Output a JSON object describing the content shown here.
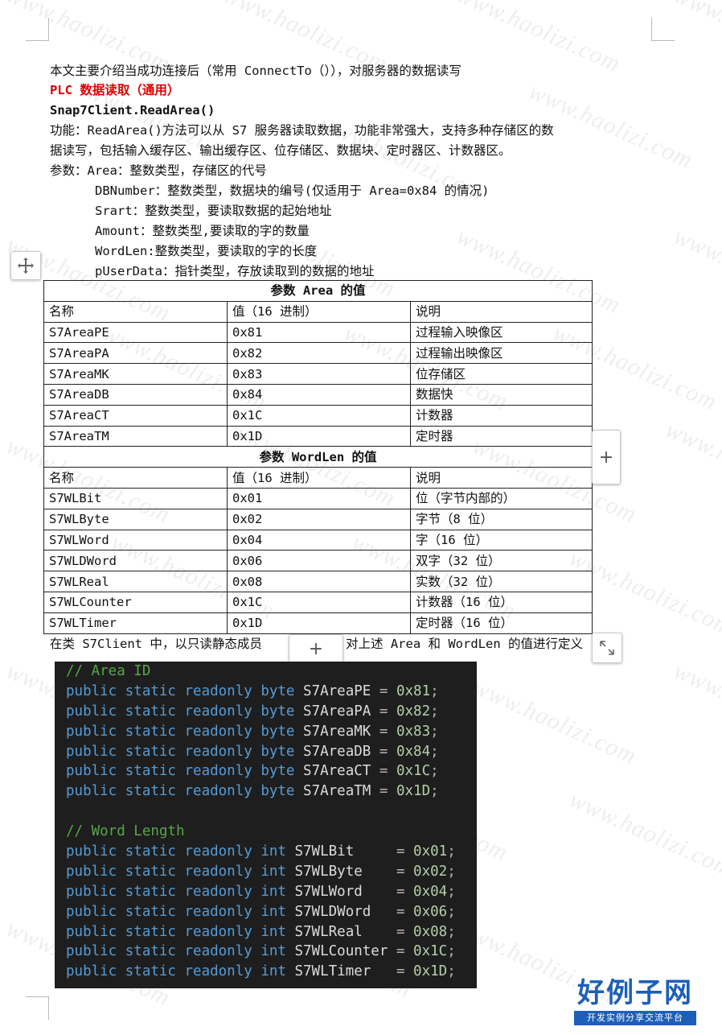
{
  "intro": {
    "line1": "本文主要介绍当成功连接后（常用 ConnectTo（）），对服务器的数据读写",
    "heading": "PLC 数据读取（通用）",
    "method": "Snap7Client.ReadArea()",
    "desc1": "功能：ReadArea()方法可以从 S7 服务器读取数据，功能非常强大，支持多种存储区的数",
    "desc2": "据读写，包括输入缓存区、输出缓存区、位存储区、数据块、定时器区、计数器区。",
    "p_area": "参数：Area：整数类型，存储区的代号",
    "p_db": "DBNumber：整数类型，数据块的编号(仅适用于 Area=0x84 的情况)",
    "p_start": "Srart：整数类型，要读取数据的起始地址",
    "p_amount": "Amount：整数类型,要读取的字的数量",
    "p_wordlen": "WordLen:整数类型，要读取的字的长度",
    "p_user": "pUserData：指针类型，存放读取到的数据的地址"
  },
  "table": {
    "area_header": "参数 Area 的值",
    "wordlen_header": "参数 WordLen 的值",
    "cols": [
      "名称",
      "值（16 进制）",
      "说明"
    ],
    "area_rows": [
      [
        "S7AreaPE",
        "0x81",
        "过程输入映像区"
      ],
      [
        "S7AreaPA",
        "0x82",
        "过程输出映像区"
      ],
      [
        "S7AreaMK",
        "0x83",
        "位存储区"
      ],
      [
        "S7AreaDB",
        "0x84",
        "数据快"
      ],
      [
        "S7AreaCT",
        "0x1C",
        "计数器"
      ],
      [
        "S7AreaTM",
        "0x1D",
        "定时器"
      ]
    ],
    "wordlen_rows": [
      [
        "S7WLBit",
        "0x01",
        "位（字节内部的）"
      ],
      [
        "S7WLByte",
        "0x02",
        "字节（8 位）"
      ],
      [
        "S7WLWord",
        "0x04",
        "字（16 位）"
      ],
      [
        "S7WLDWord",
        "0x06",
        "双字（32 位）"
      ],
      [
        "S7WLReal",
        "0x08",
        "实数（32 位）"
      ],
      [
        "S7WLCounter",
        "0x1C",
        "计数器（16 位）"
      ],
      [
        "S7WLTimer",
        "0x1D",
        "定时器（16 位）"
      ]
    ]
  },
  "after_table": {
    "left": "在类 S7Client 中，以只读静态成员",
    "right": "对上述 Area 和 WordLen 的值进行定义"
  },
  "code": {
    "comment1": "// Area ID",
    "area_lines": [
      {
        "type": "byte",
        "name": "S7AreaPE",
        "value": "0x81"
      },
      {
        "type": "byte",
        "name": "S7AreaPA",
        "value": "0x82"
      },
      {
        "type": "byte",
        "name": "S7AreaMK",
        "value": "0x83"
      },
      {
        "type": "byte",
        "name": "S7AreaDB",
        "value": "0x84"
      },
      {
        "type": "byte",
        "name": "S7AreaCT",
        "value": "0x1C"
      },
      {
        "type": "byte",
        "name": "S7AreaTM",
        "value": "0x1D"
      }
    ],
    "comment2": "// Word Length",
    "wl_lines": [
      {
        "type": "int",
        "name": "S7WLBit    ",
        "value": "0x01"
      },
      {
        "type": "int",
        "name": "S7WLByte   ",
        "value": "0x02"
      },
      {
        "type": "int",
        "name": "S7WLWord   ",
        "value": "0x04"
      },
      {
        "type": "int",
        "name": "S7WLDWord  ",
        "value": "0x06"
      },
      {
        "type": "int",
        "name": "S7WLReal   ",
        "value": "0x08"
      },
      {
        "type": "int",
        "name": "S7WLCounter",
        "value": "0x1C"
      },
      {
        "type": "int",
        "name": "S7WLTimer  ",
        "value": "0x1D"
      }
    ],
    "modifiers": "public static readonly"
  },
  "watermark": "www.haolizi.com",
  "logo": {
    "title": "好例子网",
    "subtitle": "开发实例分享交流平台"
  },
  "icons": {
    "move": "move-handle-icon",
    "add": "plus-icon",
    "resize": "resize-icon"
  },
  "colors": {
    "heading_red": "#e00000",
    "code_bg": "#1e1e1e",
    "keyword": "#569cd6",
    "comment": "#57a64a",
    "logo_blue": "#1d5fb8"
  }
}
